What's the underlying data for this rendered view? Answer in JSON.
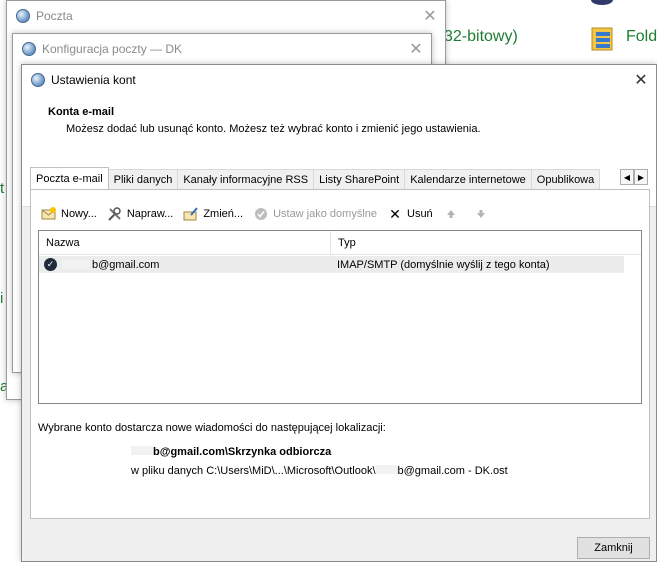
{
  "background": {
    "green_text": "er (32-bitowy)",
    "folder_label": "Fold"
  },
  "win_poczta": {
    "title": "Poczta"
  },
  "win_konfig": {
    "title": "Konfiguracja poczty — DK"
  },
  "dialog": {
    "title": "Ustawienia kont",
    "heading": "Konta e-mail",
    "subheading": "Możesz dodać lub usunąć konto. Możesz też wybrać konto i zmienić jego ustawienia.",
    "tabs": [
      "Poczta e-mail",
      "Pliki danych",
      "Kanały informacyjne RSS",
      "Listy SharePoint",
      "Kalendarze internetowe",
      "Opublikowa"
    ],
    "toolbar": {
      "new": "Nowy...",
      "repair": "Napraw...",
      "change": "Zmień...",
      "set_default": "Ustaw jako domyślne",
      "remove": "Usuń"
    },
    "list": {
      "col_name": "Nazwa",
      "col_type": "Typ",
      "rows": [
        {
          "name": "b@gmail.com",
          "type": "IMAP/SMTP (domyślnie wyślij z tego konta)"
        }
      ]
    },
    "info_line": "Wybrane konto dostarcza nowe wiadomości do następującej lokalizacji:",
    "location_bold": "b@gmail.com\\Skrzynka odbiorcza",
    "location_path_prefix": "w pliku danych C:\\Users\\MiD\\...\\Microsoft\\Outlook\\",
    "location_path_suffix": "b@gmail.com - DK.ost",
    "close_button": "Zamknij"
  }
}
